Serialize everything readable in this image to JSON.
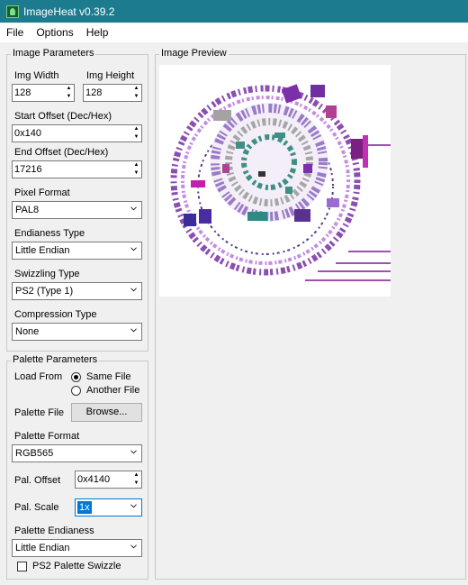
{
  "window": {
    "title": "ImageHeat v0.39.2"
  },
  "menu": {
    "items": [
      "File",
      "Options",
      "Help"
    ]
  },
  "image_params": {
    "legend": "Image Parameters",
    "width_label": "Img Width",
    "width_value": "128",
    "height_label": "Img Height",
    "height_value": "128",
    "start_offset_label": "Start Offset (Dec/Hex)",
    "start_offset_value": "0x140",
    "end_offset_label": "End Offset (Dec/Hex)",
    "end_offset_value": "17216",
    "pixel_format_label": "Pixel Format",
    "pixel_format_value": "PAL8",
    "endianess_label": "Endianess Type",
    "endianess_value": "Little Endian",
    "swizzling_label": "Swizzling Type",
    "swizzling_value": "PS2 (Type 1)",
    "compression_label": "Compression Type",
    "compression_value": "None"
  },
  "palette_params": {
    "legend": "Palette Parameters",
    "load_from_label": "Load From",
    "same_file_label": "Same File",
    "another_file_label": "Another File",
    "load_from_selected": "Same File",
    "palette_file_label": "Palette File",
    "browse_label": "Browse...",
    "palette_format_label": "Palette Format",
    "palette_format_value": "RGB565",
    "pal_offset_label": "Pal. Offset",
    "pal_offset_value": "0x4140",
    "pal_scale_label": "Pal. Scale",
    "pal_scale_value": "1x",
    "palette_endianess_label": "Palette Endianess",
    "palette_endianess_value": "Little Endian",
    "ps2_swizzle_label": "PS2 Palette Swizzle",
    "ps2_swizzle_checked": false
  },
  "preview": {
    "legend": "Image Preview"
  }
}
